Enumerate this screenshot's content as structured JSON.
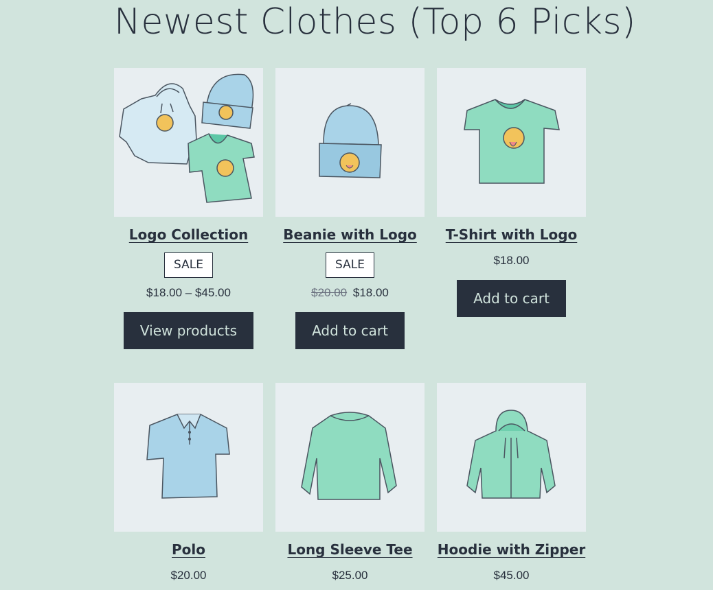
{
  "page": {
    "title": "Newest Clothes (Top 6 Picks)"
  },
  "products": [
    {
      "name": "Logo Collection",
      "badge": "SALE",
      "price": "$18.00 – $45.00",
      "button": "View products",
      "icon": "logo-collection-image"
    },
    {
      "name": "Beanie with Logo",
      "badge": "SALE",
      "old_price": "$20.00",
      "price": "$18.00",
      "button": "Add to cart",
      "icon": "beanie-image"
    },
    {
      "name": "T-Shirt with Logo",
      "price": "$18.00",
      "button": "Add to cart",
      "icon": "tshirt-image"
    },
    {
      "name": "Polo",
      "price": "$20.00",
      "icon": "polo-image"
    },
    {
      "name": "Long Sleeve Tee",
      "price": "$25.00",
      "icon": "long-sleeve-tee-image"
    },
    {
      "name": "Hoodie with Zipper",
      "price": "$45.00",
      "icon": "hoodie-zipper-image"
    }
  ],
  "colors": {
    "background": "#d1e4dd",
    "text": "#28303d",
    "button_bg": "#28303d",
    "button_text": "#d1e4dd",
    "image_bg": "#e8eef1",
    "mint": "#8fdcc0",
    "blue": "#a9d3e8"
  }
}
